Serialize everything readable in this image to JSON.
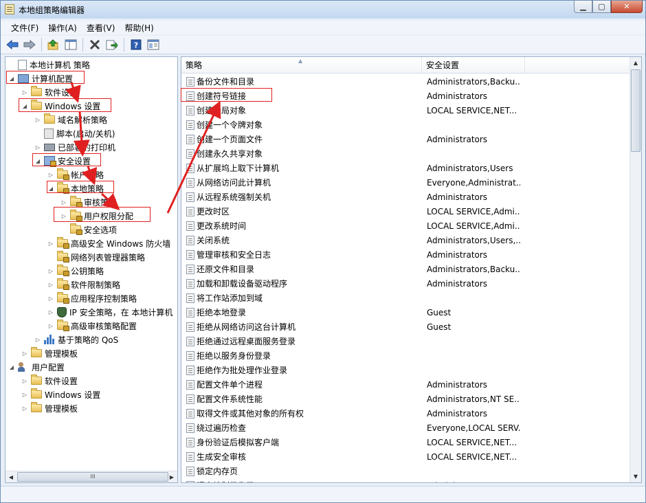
{
  "window": {
    "title": "本地组策略编辑器",
    "min_glyph": "▁",
    "max_glyph": "▢",
    "close_glyph": "✕"
  },
  "menu": [
    "文件(F)",
    "操作(A)",
    "查看(V)",
    "帮助(H)"
  ],
  "toolbar": {
    "icons": [
      "back-arrow-icon",
      "forward-arrow-icon",
      "up-folder-icon",
      "show-hide-tree-icon",
      "delete-icon",
      "export-list-icon",
      "help-icon",
      "properties-icon"
    ]
  },
  "tree": [
    {
      "label": "本地计算机 策略",
      "icon": "doc",
      "depth": 0,
      "exp": "none"
    },
    {
      "label": "计算机配置",
      "icon": "computer",
      "depth": 0,
      "exp": "expanded",
      "highlight": true
    },
    {
      "label": "软件设置",
      "icon": "folder",
      "depth": 1,
      "exp": "collapsed"
    },
    {
      "label": "Windows 设置",
      "icon": "folder",
      "depth": 1,
      "exp": "expanded",
      "highlight": true
    },
    {
      "label": "域名解析策略",
      "icon": "folder",
      "depth": 2,
      "exp": "collapsed"
    },
    {
      "label": "脚本(启动/关机)",
      "icon": "script",
      "depth": 2,
      "exp": "none"
    },
    {
      "label": "已部署的打印机",
      "icon": "printer",
      "depth": 2,
      "exp": "collapsed"
    },
    {
      "label": "安全设置",
      "icon": "security",
      "depth": 2,
      "exp": "expanded",
      "highlight": true
    },
    {
      "label": "帐户策略",
      "icon": "folder-lock",
      "depth": 3,
      "exp": "collapsed"
    },
    {
      "label": "本地策略",
      "icon": "folder-lock",
      "depth": 3,
      "exp": "expanded",
      "highlight": true
    },
    {
      "label": "审核策略",
      "icon": "folder-lock",
      "depth": 4,
      "exp": "collapsed"
    },
    {
      "label": "用户权限分配",
      "icon": "folder-lock",
      "depth": 4,
      "exp": "collapsed",
      "highlight": true,
      "selected": true
    },
    {
      "label": "安全选项",
      "icon": "folder-lock",
      "depth": 4,
      "exp": "none"
    },
    {
      "label": "高级安全 Windows 防火墙",
      "icon": "folder-lock",
      "depth": 3,
      "exp": "collapsed"
    },
    {
      "label": "网络列表管理器策略",
      "icon": "folder-lock",
      "depth": 3,
      "exp": "none"
    },
    {
      "label": "公钥策略",
      "icon": "folder-lock",
      "depth": 3,
      "exp": "collapsed"
    },
    {
      "label": "软件限制策略",
      "icon": "folder-lock",
      "depth": 3,
      "exp": "collapsed"
    },
    {
      "label": "应用程序控制策略",
      "icon": "folder-lock",
      "depth": 3,
      "exp": "collapsed"
    },
    {
      "label": "IP 安全策略，在 本地计算机",
      "icon": "ipsec",
      "depth": 3,
      "exp": "collapsed"
    },
    {
      "label": "高级审核策略配置",
      "icon": "folder-lock",
      "depth": 3,
      "exp": "collapsed"
    },
    {
      "label": "基于策略的 QoS",
      "icon": "qos",
      "depth": 2,
      "exp": "collapsed"
    },
    {
      "label": "管理模板",
      "icon": "folder",
      "depth": 1,
      "exp": "collapsed"
    },
    {
      "label": "用户配置",
      "icon": "users",
      "depth": 0,
      "exp": "expanded"
    },
    {
      "label": "软件设置",
      "icon": "folder",
      "depth": 1,
      "exp": "collapsed"
    },
    {
      "label": "Windows 设置",
      "icon": "folder",
      "depth": 1,
      "exp": "collapsed"
    },
    {
      "label": "管理模板",
      "icon": "folder",
      "depth": 1,
      "exp": "collapsed"
    }
  ],
  "list": {
    "columns": [
      "策略",
      "安全设置",
      ""
    ],
    "sort_glyph": "▲",
    "rows": [
      {
        "policy": "备份文件和目录",
        "setting": "Administrators,Backu..."
      },
      {
        "policy": "创建符号链接",
        "setting": "Administrators",
        "highlight": true
      },
      {
        "policy": "创建全局对象",
        "setting": "LOCAL SERVICE,NET..."
      },
      {
        "policy": "创建一个令牌对象",
        "setting": ""
      },
      {
        "policy": "创建一个页面文件",
        "setting": "Administrators"
      },
      {
        "policy": "创建永久共享对象",
        "setting": ""
      },
      {
        "policy": "从扩展坞上取下计算机",
        "setting": "Administrators,Users"
      },
      {
        "policy": "从网络访问此计算机",
        "setting": "Everyone,Administrat..."
      },
      {
        "policy": "从远程系统强制关机",
        "setting": "Administrators"
      },
      {
        "policy": "更改时区",
        "setting": "LOCAL SERVICE,Admi..."
      },
      {
        "policy": "更改系统时间",
        "setting": "LOCAL SERVICE,Admi..."
      },
      {
        "policy": "关闭系统",
        "setting": "Administrators,Users,..."
      },
      {
        "policy": "管理审核和安全日志",
        "setting": "Administrators"
      },
      {
        "policy": "还原文件和目录",
        "setting": "Administrators,Backu..."
      },
      {
        "policy": "加载和卸载设备驱动程序",
        "setting": "Administrators"
      },
      {
        "policy": "将工作站添加到域",
        "setting": ""
      },
      {
        "policy": "拒绝本地登录",
        "setting": "Guest"
      },
      {
        "policy": "拒绝从网络访问这台计算机",
        "setting": "Guest"
      },
      {
        "policy": "拒绝通过远程桌面服务登录",
        "setting": ""
      },
      {
        "policy": "拒绝以服务身份登录",
        "setting": ""
      },
      {
        "policy": "拒绝作为批处理作业登录",
        "setting": ""
      },
      {
        "policy": "配置文件单个进程",
        "setting": "Administrators"
      },
      {
        "policy": "配置文件系统性能",
        "setting": "Administrators,NT SE..."
      },
      {
        "policy": "取得文件或其他对象的所有权",
        "setting": "Administrators"
      },
      {
        "policy": "绕过遍历检查",
        "setting": "Everyone,LOCAL SERV..."
      },
      {
        "policy": "身份验证后模拟客户端",
        "setting": "LOCAL SERVICE,NET..."
      },
      {
        "policy": "生成安全审核",
        "setting": "LOCAL SERVICE,NET..."
      },
      {
        "policy": "锁定内存页",
        "setting": ""
      },
      {
        "policy": "提高计划优先级",
        "setting": "Administrators"
      }
    ]
  },
  "scroll": {
    "up": "▲",
    "down": "▼",
    "left": "◀",
    "right": "▶",
    "grip": "III"
  },
  "annotation_color": "#e02020"
}
